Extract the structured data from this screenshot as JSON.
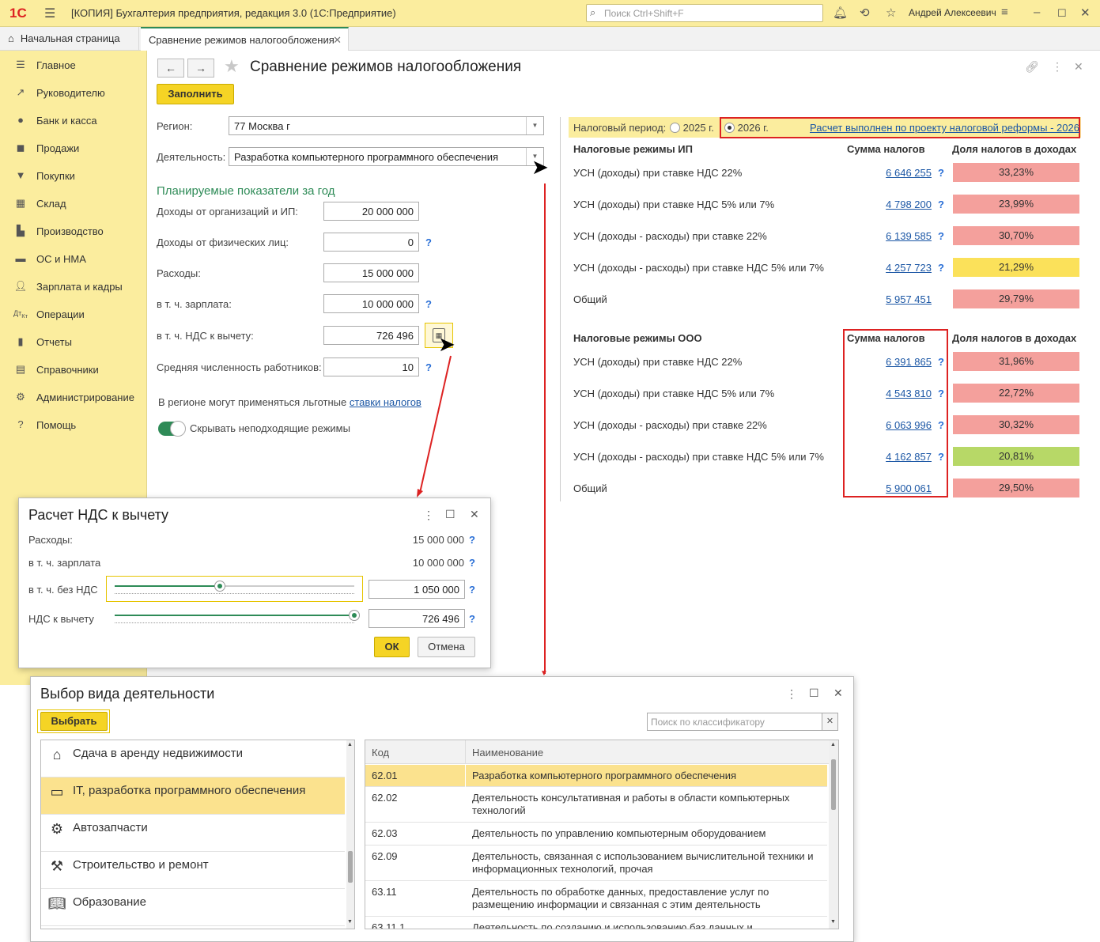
{
  "app": {
    "logo": "1С",
    "title": "[КОПИЯ] Бухгалтерия предприятия, редакция 3.0  (1С:Предприятие)",
    "search_placeholder": "Поиск Ctrl+Shift+F",
    "user": "Андрей Алексеевич"
  },
  "tabs": [
    {
      "label": "Начальная страница"
    },
    {
      "label": "Сравнение режимов налогообложения"
    }
  ],
  "sidebar": {
    "items": [
      {
        "label": "Главное",
        "icon": "menu-lines-icon"
      },
      {
        "label": "Руководителю",
        "icon": "trend-icon"
      },
      {
        "label": "Банк и касса",
        "icon": "coin-icon"
      },
      {
        "label": "Продажи",
        "icon": "bag-icon"
      },
      {
        "label": "Покупки",
        "icon": "cart-icon"
      },
      {
        "label": "Склад",
        "icon": "grid-icon"
      },
      {
        "label": "Производство",
        "icon": "factory-icon"
      },
      {
        "label": "ОС и НМА",
        "icon": "truck-icon"
      },
      {
        "label": "Зарплата и кадры",
        "icon": "person-icon"
      },
      {
        "label": "Операции",
        "icon": "dt-kt-icon"
      },
      {
        "label": "Отчеты",
        "icon": "bar-chart-icon"
      },
      {
        "label": "Справочники",
        "icon": "book-icon"
      },
      {
        "label": "Администрирование",
        "icon": "gear-icon"
      },
      {
        "label": "Помощь",
        "icon": "help-icon"
      }
    ]
  },
  "form": {
    "title": "Сравнение режимов налогообложения",
    "fill_button": "Заполнить",
    "region_label": "Регион:",
    "region_value": "77 Москва г",
    "activity_label": "Деятельность:",
    "activity_value": "Разработка компьютерного программного обеспечения",
    "plan_title": "Планируемые показатели за год",
    "rows": [
      {
        "label": "Доходы от организаций и ИП:",
        "value": "20 000 000",
        "help": ""
      },
      {
        "label": "Доходы от физических лиц:",
        "value": "0",
        "help": "?"
      },
      {
        "label": "Расходы:",
        "value": "15 000 000",
        "help": ""
      },
      {
        "label": "в т. ч. зарплата:",
        "value": "10 000 000",
        "help": "?"
      },
      {
        "label": "в т. ч. НДС к вычету:",
        "value": "726 496",
        "help": ""
      },
      {
        "label": "Средняя численность работников:",
        "value": "10",
        "help": "?"
      }
    ],
    "note_prefix": "В регионе могут применяться льготные ",
    "note_link": "ставки налогов",
    "toggle_label": "Скрывать неподходящие режимы"
  },
  "results": {
    "period_label": "Налоговый период:",
    "period_2025": "2025 г.",
    "period_2026": "2026 г.",
    "reform_link": "Расчет выполнен по проекту налоговой реформы - 2026",
    "ip_header": "Налоговые режимы ИП",
    "ooo_header": "Налоговые режимы ООО",
    "sum_header": "Сумма налогов",
    "share_header": "Доля налогов в доходах",
    "ip": [
      {
        "name": "УСН (доходы) при ставке НДС 22%",
        "sum": "6 646 255",
        "help": "?",
        "share": "33,23%",
        "color": "#f4a09c"
      },
      {
        "name": "УСН (доходы) при ставке НДС 5% или 7%",
        "sum": "4 798 200",
        "help": "?",
        "share": "23,99%",
        "color": "#f4a09c"
      },
      {
        "name": "УСН (доходы - расходы) при ставке 22%",
        "sum": "6 139 585",
        "help": "?",
        "share": "30,70%",
        "color": "#f4a09c"
      },
      {
        "name": "УСН (доходы - расходы) при ставке НДС 5% или 7%",
        "sum": "4 257 723",
        "help": "?",
        "share": "21,29%",
        "color": "#fbe15a"
      },
      {
        "name": "Общий",
        "sum": "5 957 451",
        "help": "",
        "share": "29,79%",
        "color": "#f4a09c"
      }
    ],
    "ooo": [
      {
        "name": "УСН (доходы) при ставке НДС 22%",
        "sum": "6 391 865",
        "help": "?",
        "share": "31,96%",
        "color": "#f4a09c"
      },
      {
        "name": "УСН (доходы) при ставке НДС 5% или 7%",
        "sum": "4 543 810",
        "help": "?",
        "share": "22,72%",
        "color": "#f4a09c"
      },
      {
        "name": "УСН (доходы - расходы) при ставке 22%",
        "sum": "6 063 996",
        "help": "?",
        "share": "30,32%",
        "color": "#f4a09c"
      },
      {
        "name": "УСН (доходы - расходы) при ставке НДС 5% или 7%",
        "sum": "4 162 857",
        "help": "?",
        "share": "20,81%",
        "color": "#b7d867"
      },
      {
        "name": "Общий",
        "sum": "5 900 061",
        "help": "",
        "share": "29,50%",
        "color": "#f4a09c"
      }
    ]
  },
  "vat_dialog": {
    "title": "Расчет НДС к вычету",
    "rows": [
      {
        "label": "Расходы:",
        "value": "15 000 000",
        "help": "?"
      },
      {
        "label": "в т. ч. зарплата",
        "value": "10 000 000",
        "help": "?"
      },
      {
        "label": "в т. ч. без НДС",
        "value": "1 050 000",
        "help": "?",
        "slider_fraction": 0.44
      },
      {
        "label": "НДС к вычету",
        "value": "726 496",
        "help": "?",
        "slider_fraction": 1.0
      }
    ],
    "ok": "ОК",
    "cancel": "Отмена"
  },
  "activity_dialog": {
    "title": "Выбор вида деятельности",
    "select_button": "Выбрать",
    "search_placeholder": "Поиск по классификатору",
    "categories": [
      {
        "label": "Сдача в аренду недвижимости",
        "icon": "house-icon",
        "selected": false
      },
      {
        "label": "IT, разработка программного обеспечения",
        "icon": "monitor-icon",
        "selected": true
      },
      {
        "label": "Автозапчасти",
        "icon": "gear-icon",
        "selected": false
      },
      {
        "label": "Строительство и ремонт",
        "icon": "tools-icon",
        "selected": false
      },
      {
        "label": "Образование",
        "icon": "open-book-icon",
        "selected": false
      }
    ],
    "col_code": "Код",
    "col_name": "Наименование",
    "codes": [
      {
        "code": "62.01",
        "name": "Разработка компьютерного программного обеспечения",
        "selected": true
      },
      {
        "code": "62.02",
        "name": "Деятельность консультативная и работы в области компьютерных технологий",
        "selected": false
      },
      {
        "code": "62.03",
        "name": "Деятельность по управлению компьютерным оборудованием",
        "selected": false
      },
      {
        "code": "62.09",
        "name": "Деятельность, связанная с использованием вычислительной техники и информационных технологий, прочая",
        "selected": false
      },
      {
        "code": "63.11",
        "name": "Деятельность по обработке данных, предоставление услуг по размещению информации и связанная с этим деятельность",
        "selected": false
      },
      {
        "code": "63.11.1",
        "name": "Деятельность по созданию и использованию баз данных и",
        "selected": false
      }
    ]
  }
}
